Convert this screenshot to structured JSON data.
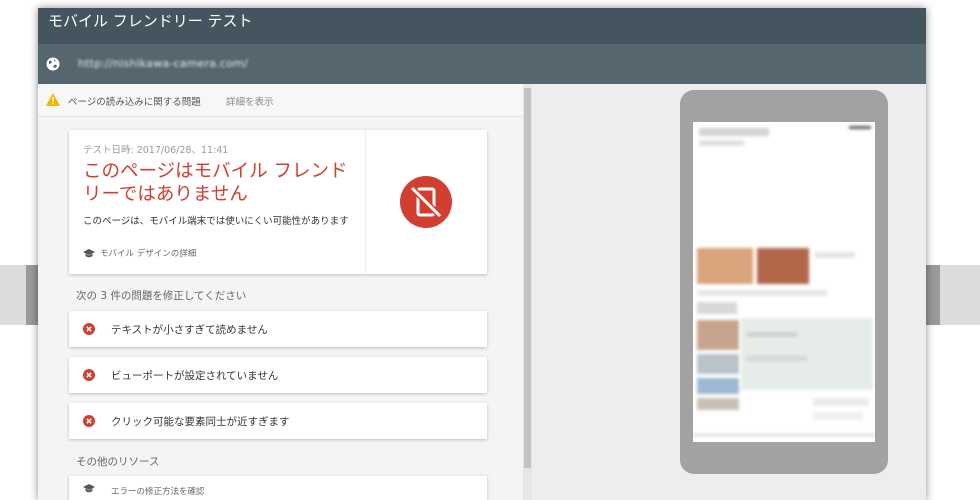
{
  "window": {
    "title": "モバイル フレンドリー テスト",
    "url": "http://nishikawa-camera.com/"
  },
  "issues_bar": {
    "text": "ページの読み込みに関する問題",
    "link": "詳細を表示"
  },
  "result": {
    "date": "テスト日時: 2017/06/28、11:41",
    "headline": "このページはモバイル フレンドリーではありません",
    "subtitle": "このページは、モバイル端末では使いにくい可能性があります",
    "design_link": "モバイル デザインの詳細",
    "icon": "not-mobile-friendly-icon",
    "accent_color": "#d23f31"
  },
  "problems": {
    "heading": "次の 3 件の問題を修正してください",
    "items": [
      "テキストが小さすぎて読めません",
      "ビューポートが設定されていません",
      "クリック可能な要素同士が近すぎます"
    ]
  },
  "resources": {
    "heading": "その他のリソース",
    "items": [
      "エラーの修正方法を確認"
    ]
  },
  "colors": {
    "titlebar": "#45555f",
    "urlbar": "#56666f",
    "error": "#d23f31"
  }
}
